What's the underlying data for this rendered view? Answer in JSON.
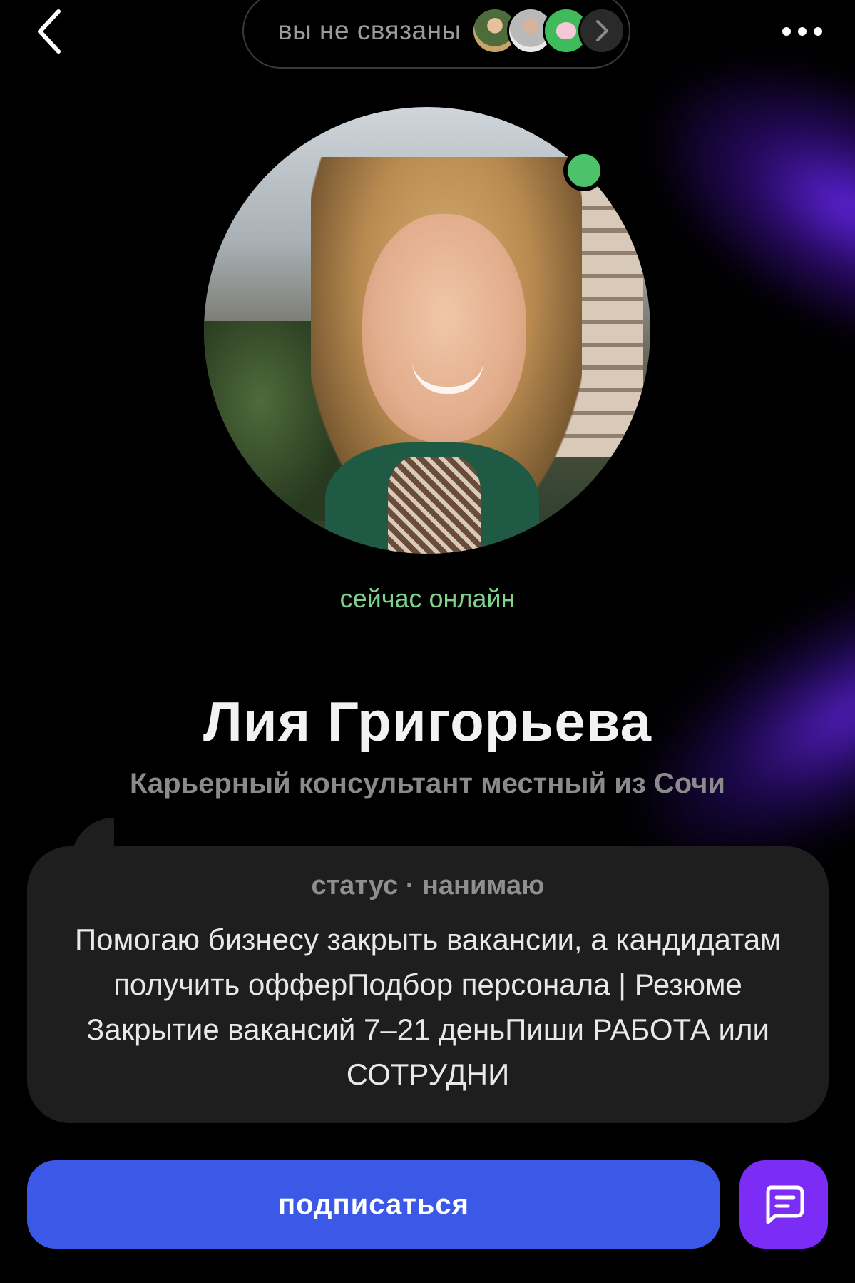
{
  "header": {
    "connections_label": "вы не связаны",
    "back_icon": "chevron-left-icon",
    "more_icon": "more-horizontal-icon"
  },
  "profile": {
    "online_status": "сейчас онлайн",
    "name": "Лия Григорьева",
    "subtitle": "Карьерный консультант местный из Сочи"
  },
  "status": {
    "label": "статус · нанимаю",
    "text": "Помогаю бизнесу закрыть вакансии, а кандидатам получить офферПодбор персонала | Резюме Закрытие вакансий 7–21 деньПиши РАБОТА или СОТРУДНИ"
  },
  "actions": {
    "subscribe_label": "подписаться",
    "chat_icon": "chat-icon"
  },
  "colors": {
    "accent_blue": "#3b59e6",
    "accent_purple": "#7b2cf5",
    "online_green": "#4cc36a"
  }
}
